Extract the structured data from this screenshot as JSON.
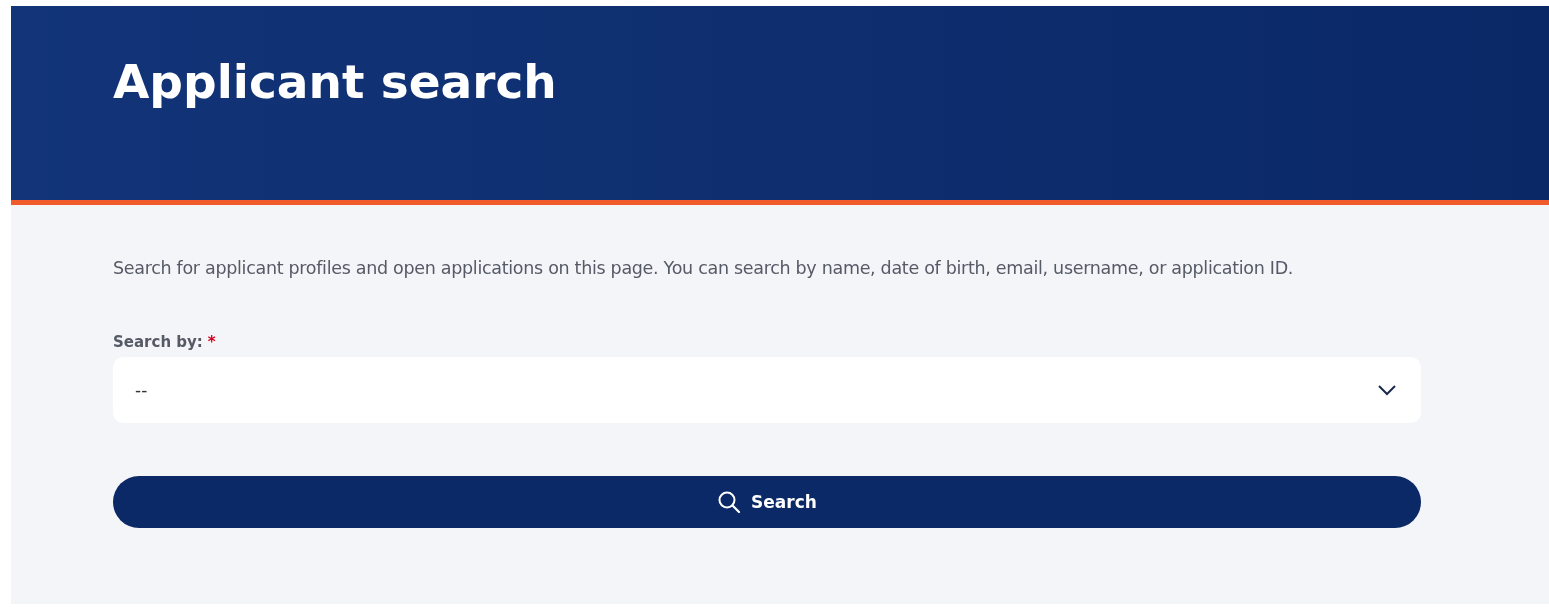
{
  "header": {
    "title": "Applicant search"
  },
  "intro": "Search for applicant profiles and open applications on this page. You can search by name, date of birth, email, username, or application ID.",
  "search_by": {
    "label": "Search by:",
    "required_mark": "*",
    "value": "--"
  },
  "search_button": {
    "label": "Search"
  }
}
